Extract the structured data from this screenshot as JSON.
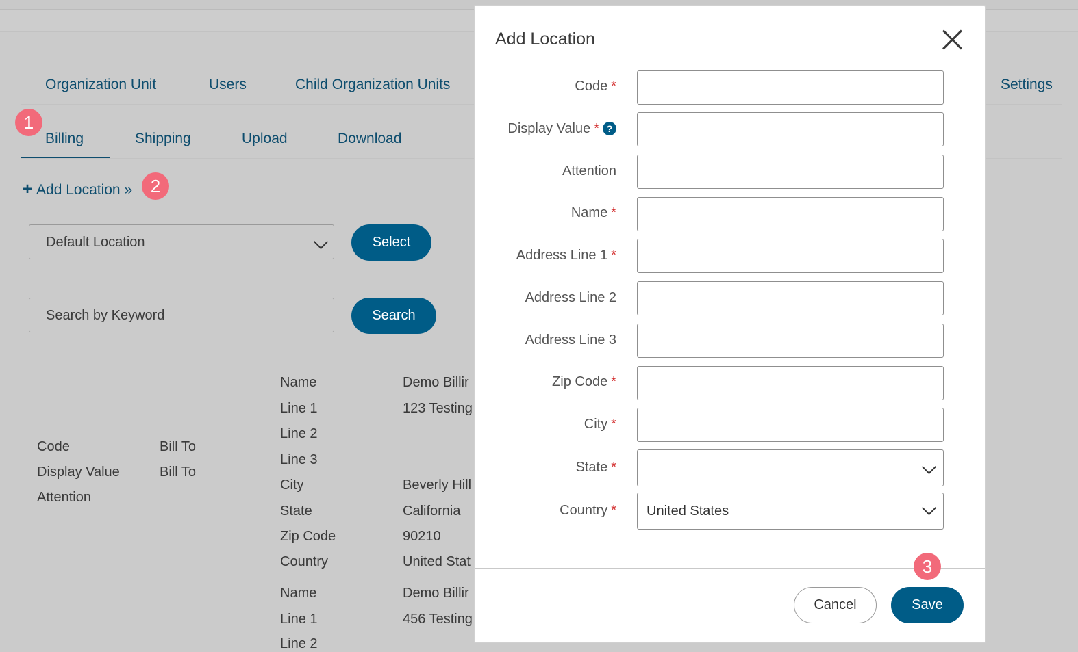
{
  "tabs_primary": [
    "Organization Unit",
    "Users",
    "Child Organization Units",
    "Settings"
  ],
  "tabs_secondary": [
    "Billing",
    "Shipping",
    "Upload",
    "Download"
  ],
  "badges": [
    "1",
    "2",
    "3"
  ],
  "add_location_link": "Add Location »",
  "location_select": {
    "value": "Default Location",
    "button": "Select"
  },
  "search": {
    "placeholder": "Search by Keyword",
    "button": "Search"
  },
  "record_left": {
    "labels": [
      "Code",
      "Display Value",
      "Attention"
    ],
    "values": [
      "Bill To",
      "Bill To",
      ""
    ]
  },
  "record_right": {
    "labels": [
      "Name",
      "Line 1",
      "Line 2",
      "Line 3",
      "City",
      "State",
      "Zip Code",
      "Country",
      "Name",
      "Line 1",
      "Line 2"
    ],
    "values": [
      "Demo Billir",
      "123 Testing",
      "",
      "",
      "Beverly Hill",
      "California",
      "90210",
      "United Stat",
      "Demo Billir",
      "456 Testing",
      ""
    ]
  },
  "modal": {
    "title": "Add Location",
    "fields": [
      {
        "label": "Code",
        "required": "*",
        "value": ""
      },
      {
        "label": "Display Value",
        "required": "*",
        "help": "?",
        "value": ""
      },
      {
        "label": "Attention",
        "required": "",
        "value": ""
      },
      {
        "label": "Name",
        "required": "*",
        "value": ""
      },
      {
        "label": "Address Line 1",
        "required": "*",
        "value": ""
      },
      {
        "label": "Address Line 2",
        "required": "",
        "value": ""
      },
      {
        "label": "Address Line 3",
        "required": "",
        "value": ""
      },
      {
        "label": "Zip Code",
        "required": "*",
        "value": ""
      },
      {
        "label": "City",
        "required": "*",
        "value": ""
      },
      {
        "label": "State",
        "required": "*",
        "value": ""
      },
      {
        "label": "Country",
        "required": "*",
        "value": "United States"
      }
    ],
    "cancel_label": "Cancel",
    "save_label": "Save"
  },
  "colors": {
    "accent": "#005c87",
    "link": "#0e4d6e",
    "badge": "#f26a7a",
    "required": "#d32f2f"
  }
}
